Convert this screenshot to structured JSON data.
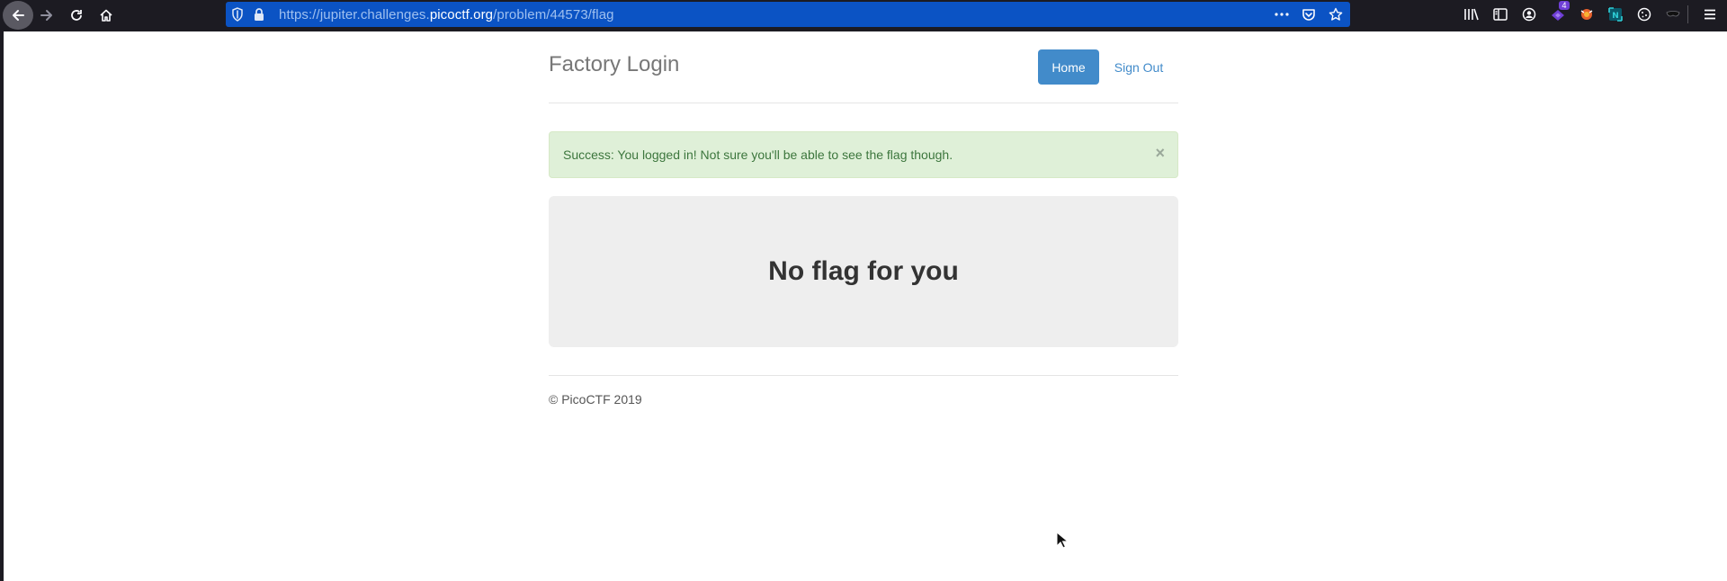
{
  "browser": {
    "url_prefix": "https://jupiter.challenges.",
    "url_domain": "picoctf.org",
    "url_path": "/problem/44573/flag",
    "extension_badge": "4",
    "icons": [
      "back-icon",
      "forward-icon",
      "reload-icon",
      "home-icon",
      "shield-icon",
      "lock-icon",
      "more-icon",
      "pocket-icon",
      "bookmark-star-icon",
      "library-icon",
      "sidebar-icon",
      "account-icon",
      "extension-icon",
      "firefox-relay-icon",
      "extension-n-icon",
      "cookie-icon",
      "mask-icon",
      "menu-icon"
    ]
  },
  "page": {
    "brand": "Factory Login",
    "nav": {
      "home": "Home",
      "sign_out": "Sign Out"
    },
    "alert": {
      "message": "Success: You logged in! Not sure you'll be able to see the flag though.",
      "close": "×"
    },
    "jumbotron_heading": "No flag for you",
    "footer": "© PicoCTF 2019"
  },
  "colors": {
    "primary": "#428bca",
    "success_bg": "#dff0d8",
    "success_text": "#3c763d",
    "urlbar": "#0b53c4"
  }
}
